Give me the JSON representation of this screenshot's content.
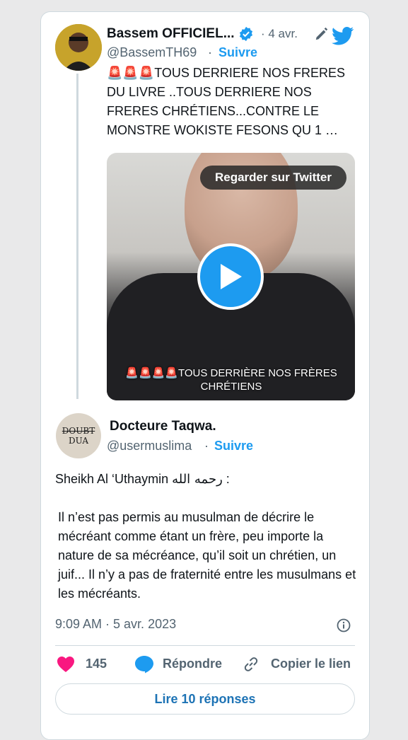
{
  "tweet": {
    "author_name": "Bassem OFFICIEL...",
    "author_handle": "@BassemTH69",
    "follow_label": "Suivre",
    "date": "· 4 avr.",
    "dot": "·",
    "sirens": "🚨🚨🚨",
    "text": "TOUS DERRIERE NOS FRERES DU LIVRE ..TOUS DERRIERE NOS FRERES CHRÉTIENS...CONTRE LE MONSTRE WOKISTE FESONS QU 1 …",
    "video": {
      "watch_label": "Regarder sur Twitter",
      "subtitle": "🚨🚨🚨🚨TOUS DERRIÈRE NOS FRÈRES CHRÉTIENS"
    }
  },
  "quoted": {
    "author_name": "Docteure Taqwa.",
    "author_handle": "@usermuslima",
    "follow_label": "Suivre",
    "avatar_line1": "DOUBT",
    "avatar_line2": "DUA",
    "line1_prefix": "Sheikh Al ‘Uthaymin ",
    "line1_arabic": "رحمه الله",
    "line1_suffix": " :",
    "paragraph": "Il n’est pas permis au musulman de décrire le mécréant comme étant un frère, peu importe la nature de sa mécréance, qu’il soit un chrétien, un juif... Il n’y a pas de fraternité entre les musulmans et les mécréants.",
    "timestamp": "9:09 AM · 5 avr. 2023"
  },
  "actions": {
    "likes": "145",
    "reply_label": "Répondre",
    "copy_label": "Copier le lien",
    "read_replies": "Lire 10 réponses"
  },
  "colors": {
    "accent": "#1d9bf0",
    "heart": "#f91880",
    "siren": "#e0245e"
  },
  "icons": [
    "verified-badge-icon",
    "pen-icon",
    "twitter-bird-icon",
    "play-icon",
    "info-icon",
    "heart-icon",
    "reply-icon",
    "link-icon"
  ]
}
